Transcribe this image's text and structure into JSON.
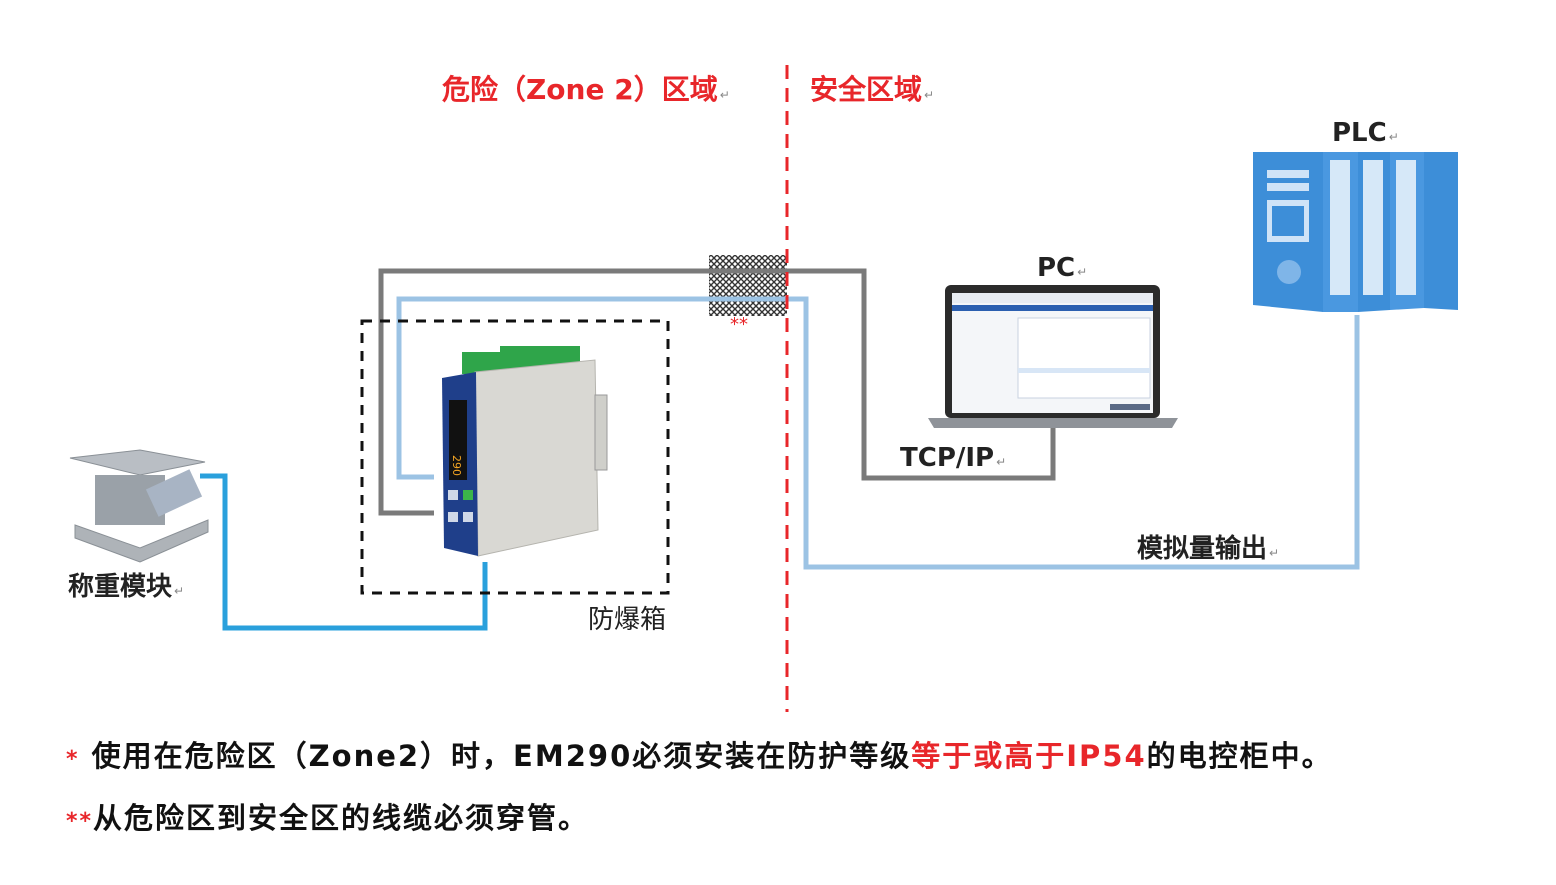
{
  "zones": {
    "hazard_label": "危险（Zone 2）区域",
    "safe_label": "安全区域",
    "return_mark": "↵"
  },
  "devices": {
    "plc": "PLC",
    "pc": "PC",
    "tcp_ip": "TCP/IP",
    "analog_output": "模拟量输出",
    "load_cell": "称重模块",
    "explosion_box": "防爆箱",
    "conduit_mark": "**",
    "display_reading": "290"
  },
  "notes": {
    "note1_star": "*",
    "note1_a": " 使用在危险区（Zone2）时，EM290必须安装在防护等级",
    "note1_red": "等于或高于IP54",
    "note1_b": "的电控柜中。",
    "note2_star": "**",
    "note2": "从危险区到安全区的线缆必须穿管。"
  },
  "colors": {
    "zone_red": "#e8262a",
    "cable_gray": "#7a7a7a",
    "cable_lightblue": "#9cc3e4",
    "cable_cyan": "#2aa0dc",
    "plc_blue": "#3d8ed8"
  }
}
